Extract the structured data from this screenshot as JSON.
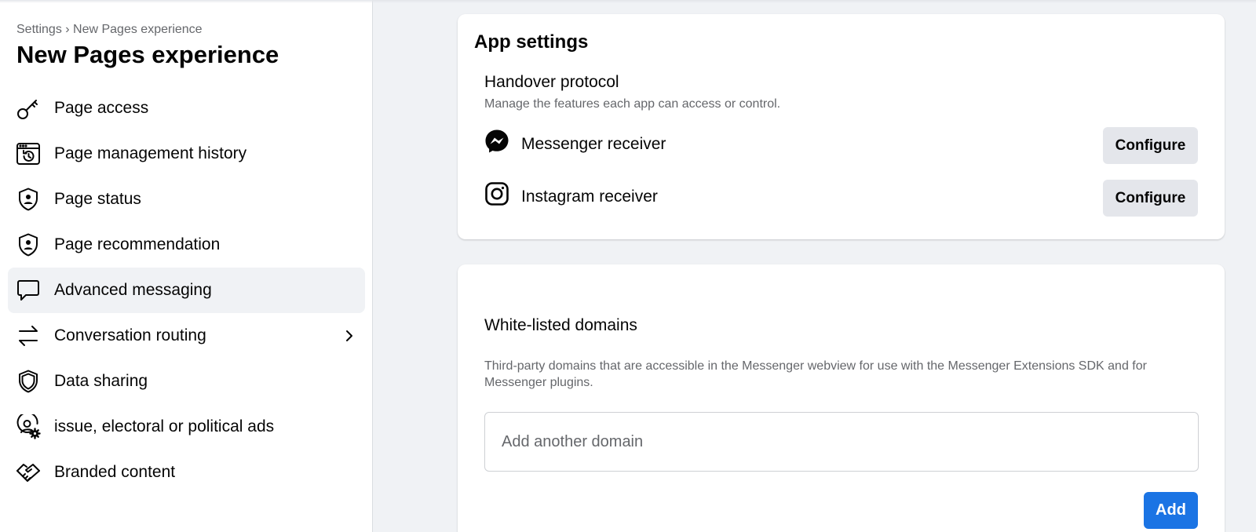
{
  "sidebar": {
    "breadcrumb": "Settings › New Pages experience",
    "title": "New Pages experience",
    "items": [
      {
        "label": "Page access",
        "icon": "key-icon"
      },
      {
        "label": "Page management history",
        "icon": "history-icon"
      },
      {
        "label": "Page status",
        "icon": "shield-person-icon"
      },
      {
        "label": "Page recommendation",
        "icon": "shield-person-icon"
      },
      {
        "label": "Advanced messaging",
        "icon": "chat-bubble-icon",
        "active": true
      },
      {
        "label": "Conversation routing",
        "icon": "swap-arrows-icon",
        "has_submenu": true
      },
      {
        "label": "Data sharing",
        "icon": "shield-icon"
      },
      {
        "label": "issue, electoral or political ads",
        "icon": "person-gear-icon"
      },
      {
        "label": "Branded content",
        "icon": "handshake-icon"
      }
    ]
  },
  "app_settings": {
    "title": "App settings",
    "handover": {
      "title": "Handover protocol",
      "description": "Manage the features each app can access or control."
    },
    "receivers": [
      {
        "label": "Messenger receiver",
        "icon": "messenger-icon",
        "button": "Configure"
      },
      {
        "label": "Instagram receiver",
        "icon": "instagram-icon",
        "button": "Configure"
      }
    ]
  },
  "whitelist": {
    "title": "White-listed domains",
    "description": "Third-party domains that are accessible in the Messenger webview for use with the Messenger Extensions SDK and for Messenger plugins.",
    "input_placeholder": "Add another domain",
    "input_value": "",
    "add_button": "Add"
  },
  "colors": {
    "accent": "#1b74e4",
    "background": "#f0f2f5",
    "secondary_text": "#65676b"
  }
}
